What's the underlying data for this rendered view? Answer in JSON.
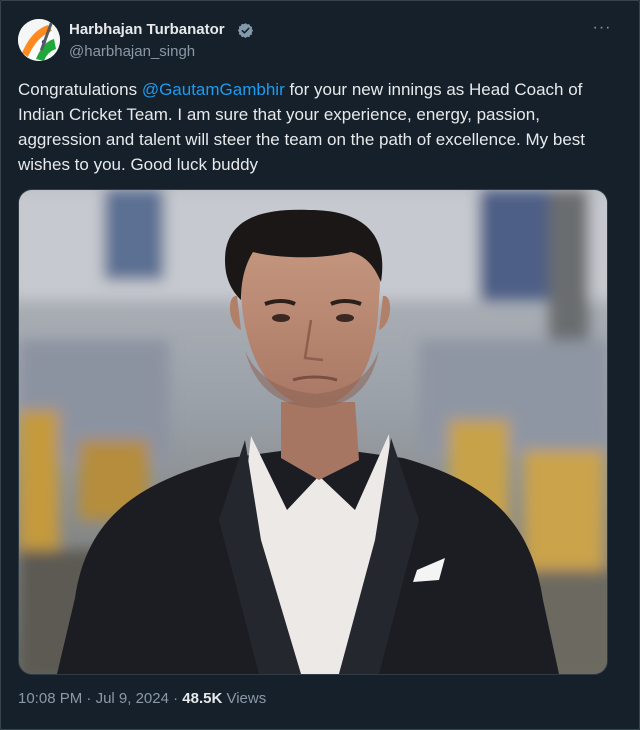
{
  "author": {
    "display_name": "Harbhajan Turbanator",
    "handle": "@harbhajan_singh",
    "verified": true,
    "avatar_icon": "tricolor-flag-avatar",
    "more_icon": "more-options-icon",
    "more_glyph": "···"
  },
  "tweet": {
    "text_before_mention": "Congratulations ",
    "mention": "@GautamGambhir",
    "text_after_mention": " for your new innings as Head Coach of Indian Cricket Team. I am sure that your experience,  energy,  passion, aggression and talent will steer the team on the path of excellence.  My best wishes to you. Good luck buddy",
    "media_description_icon": "photo-man-in-black-suit",
    "time": "10:08 PM",
    "separator": " · ",
    "date": "Jul 9, 2024",
    "separator2": " · ",
    "views_count": "48.5K",
    "views_label": " Views"
  },
  "colors": {
    "background": "#15202b",
    "text": "#e7e9ea",
    "muted": "#8b98a5",
    "link": "#1d9bf0",
    "verified_badge": "#829aab"
  }
}
